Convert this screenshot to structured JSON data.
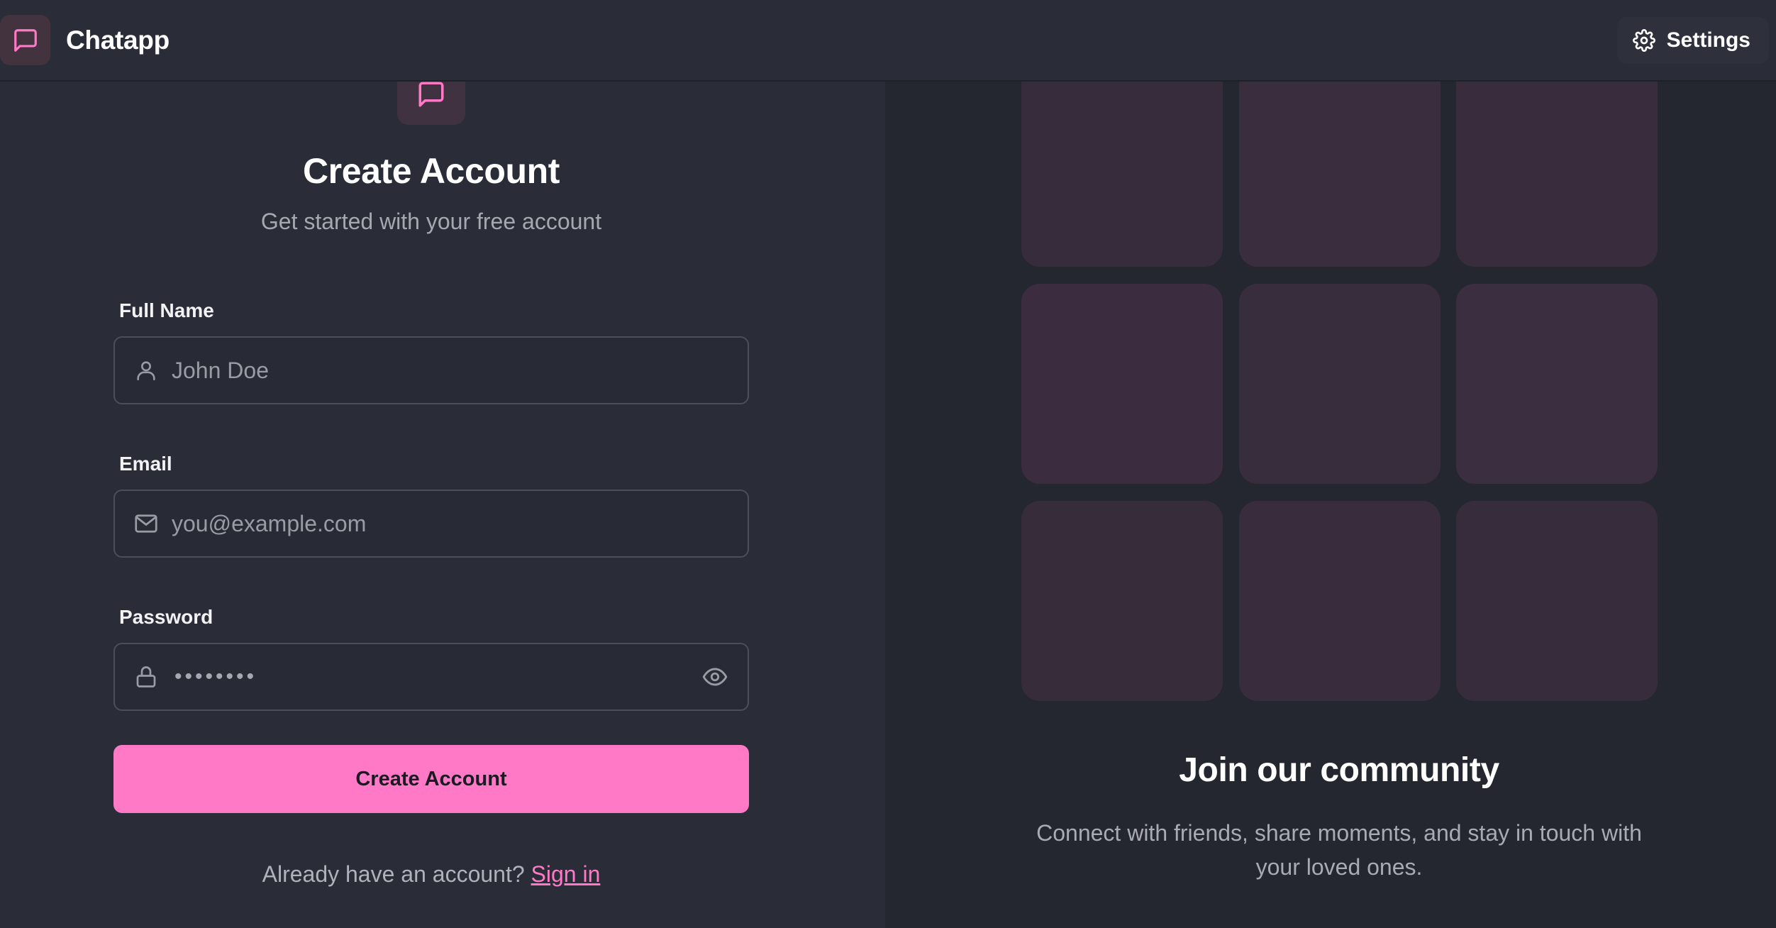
{
  "app": {
    "name": "Chatapp"
  },
  "header": {
    "settings_label": "Settings"
  },
  "colors": {
    "accent": "#ff79c6",
    "background": "#2a2d38",
    "panel_right": "#252730"
  },
  "form": {
    "title": "Create Account",
    "subtitle": "Get started with your free account",
    "full_name": {
      "label": "Full Name",
      "placeholder": "John Doe",
      "icon": "user-icon"
    },
    "email": {
      "label": "Email",
      "placeholder": "you@example.com",
      "icon": "mail-icon"
    },
    "password": {
      "label": "Password",
      "masked_value": "••••••••",
      "icon": "lock-icon",
      "toggle_icon": "eye-icon"
    },
    "submit_label": "Create Account",
    "signin_prompt": "Already have an account?",
    "signin_link": "Sign in"
  },
  "community": {
    "title": "Join our community",
    "text": "Connect with friends, share moments, and stay in touch with your loved ones."
  }
}
